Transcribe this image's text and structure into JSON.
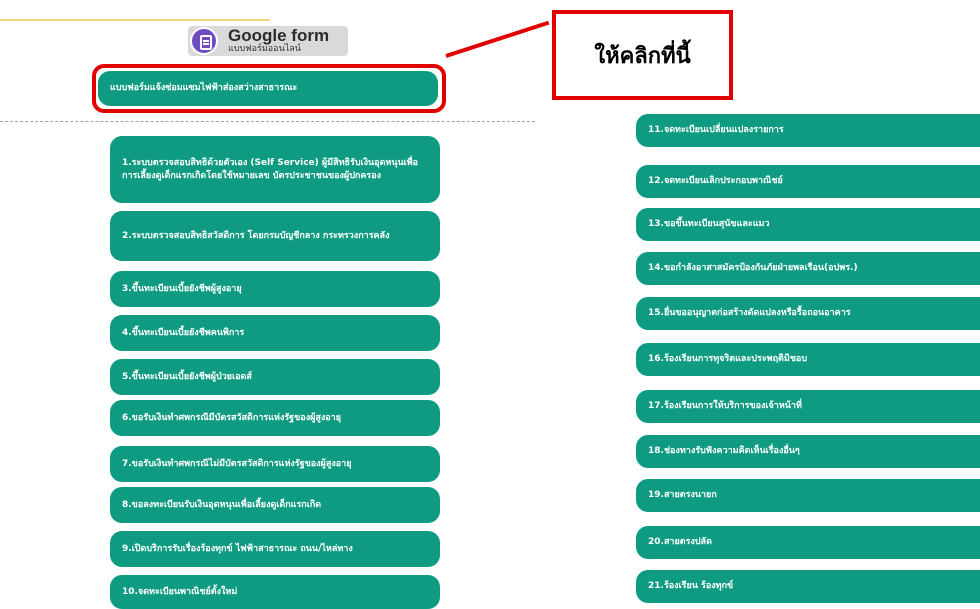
{
  "logo": {
    "title": "Google form",
    "subtitle": "แบบฟอร์มออนไลน์",
    "icon": "google-forms-icon",
    "badge_color": "#6f4cc2"
  },
  "featured_form": {
    "label": "แบบฟอร์มแจ้งซ่อมแซมไฟฟ้าส่องสว่างสาธารณะ"
  },
  "callout": {
    "text": "ให้คลิกที่นี้",
    "color": "#e10000"
  },
  "theme": {
    "button_color": "#0f9b82"
  },
  "left_column": [
    "1.ระบบตรวจสอบสิทธิด้วยตัวเอง (Self Service) ผู้มีสิทธิรับเงินอุดหนุนเพื่อการเลี้ยงดูเด็กแรกเกิดโดยใช้หมายเลข บัตรประชาชนของผู้ปกครอง",
    "2.ระบบตรวจสอบสิทธิสวัสดิการ โดยกรมบัญชีกลาง กระทรวงการคลัง",
    "3.ขึ้นทะเบียนเบี้ยยังชีพผู้สูงอายุ",
    "4.ขึ้นทะเบียนเบี้ยยังชีพคนพิการ",
    "5.ขึ้นทะเบียนเบี้ยยังชีพผู้ป่วยเอดส์",
    "6.ขอรับเงินทำศพกรณีมีบัตรสวัสดิการแห่งรัฐของผู้สูงอายุ",
    "7.ขอรับเงินทำศพกรณีไม่มีบัตรสวัสดิการแห่งรัฐของผู้สูงอายุ",
    "8.ขอลงทะเบียนรับเงินอุดหนุนเพื่อเลี้ยงดูเด็กแรกเกิด",
    "9.เปิดบริการรับเรื่องร้องทุกข์ ไฟฟ้าสาธารณะ ถนน/ไหล่ทาง",
    "10.จดทะเบียนพาณิชย์ตั้งใหม่"
  ],
  "right_column": [
    "11.จดทะเบียนเปลี่ยนแปลงรายการ",
    "12.จดทะเบียนเลิกประกอบพาณิชย์",
    "13.ขอขึ้นทะเบียนสุนัขและแมว",
    "14.ขอกำลังอาสาสมัครป้องกันภัยฝ่ายพลเรือน(อปพร.)",
    "15.ยื่นขออนุญาตก่อสร้างดัดแปลงหรือรื้อถอนอาคาร",
    "16.ร้องเรียนการทุจริตและประพฤติมิชอบ",
    "17.ร้องเรียนการให้บริการของเจ้าหน้าที่",
    "18.ช่องทางรับฟังความคิดเห็นเรื่องอื่นๆ",
    "19.สายตรงนายก",
    "20.สายตรงปลัด",
    "21.ร้องเรียน ร้องทุกข์"
  ]
}
